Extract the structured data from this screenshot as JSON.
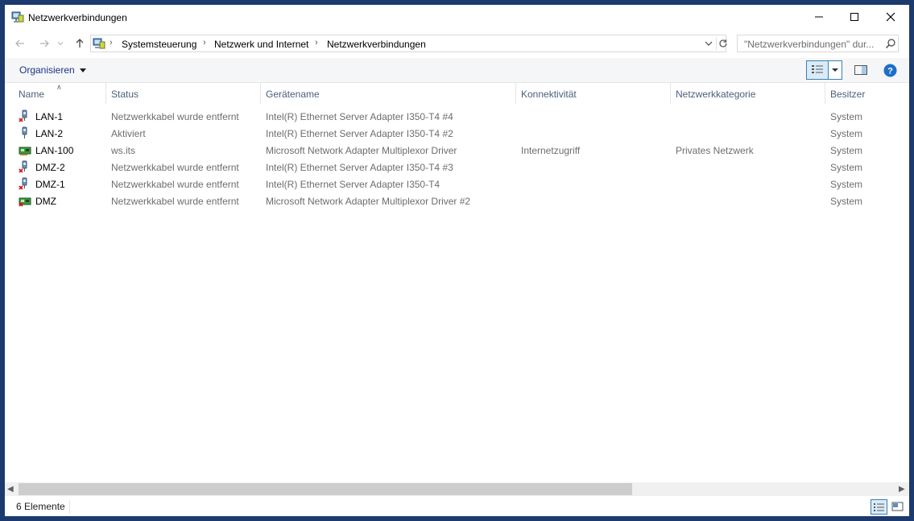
{
  "window": {
    "title": "Netzwerkverbindungen"
  },
  "address": {
    "crumbs": [
      "Systemsteuerung",
      "Netzwerk und Internet",
      "Netzwerkverbindungen"
    ],
    "search_placeholder": "\"Netzwerkverbindungen\" dur..."
  },
  "toolbar": {
    "organize_label": "Organisieren"
  },
  "columns": [
    "Name",
    "Status",
    "Gerätename",
    "Konnektivität",
    "Netzwerkkategorie",
    "Besitzer"
  ],
  "connections": [
    {
      "name": "LAN-1",
      "status": "Netzwerkkabel wurde entfernt",
      "device": "Intel(R) Ethernet Server Adapter I350-T4 #4",
      "connectivity": "",
      "category": "",
      "owner": "System",
      "icon": "wired-adapter-disconnected-icon"
    },
    {
      "name": "LAN-2",
      "status": "Aktiviert",
      "device": "Intel(R) Ethernet Server Adapter I350-T4 #2",
      "connectivity": "",
      "category": "",
      "owner": "System",
      "icon": "wired-adapter-icon"
    },
    {
      "name": "LAN-100",
      "status": "ws.its",
      "device": "Microsoft Network Adapter Multiplexor Driver",
      "connectivity": "Internetzugriff",
      "category": "Privates Netzwerk",
      "owner": "System",
      "icon": "network-card-icon"
    },
    {
      "name": "DMZ-2",
      "status": "Netzwerkkabel wurde entfernt",
      "device": "Intel(R) Ethernet Server Adapter I350-T4 #3",
      "connectivity": "",
      "category": "",
      "owner": "System",
      "icon": "wired-adapter-disconnected-icon"
    },
    {
      "name": "DMZ-1",
      "status": "Netzwerkkabel wurde entfernt",
      "device": "Intel(R) Ethernet Server Adapter I350-T4",
      "connectivity": "",
      "category": "",
      "owner": "System",
      "icon": "wired-adapter-disconnected-icon"
    },
    {
      "name": "DMZ",
      "status": "Netzwerkkabel wurde entfernt",
      "device": "Microsoft Network Adapter Multiplexor Driver #2",
      "connectivity": "",
      "category": "",
      "owner": "System",
      "icon": "network-card-disconnected-icon"
    }
  ],
  "statusbar": {
    "count_text": "6 Elemente"
  },
  "colors": {
    "accent": "#3c7fb1",
    "link": "#1e3287",
    "help": "#1e6fc7",
    "desktop": "#1c3a6e"
  }
}
